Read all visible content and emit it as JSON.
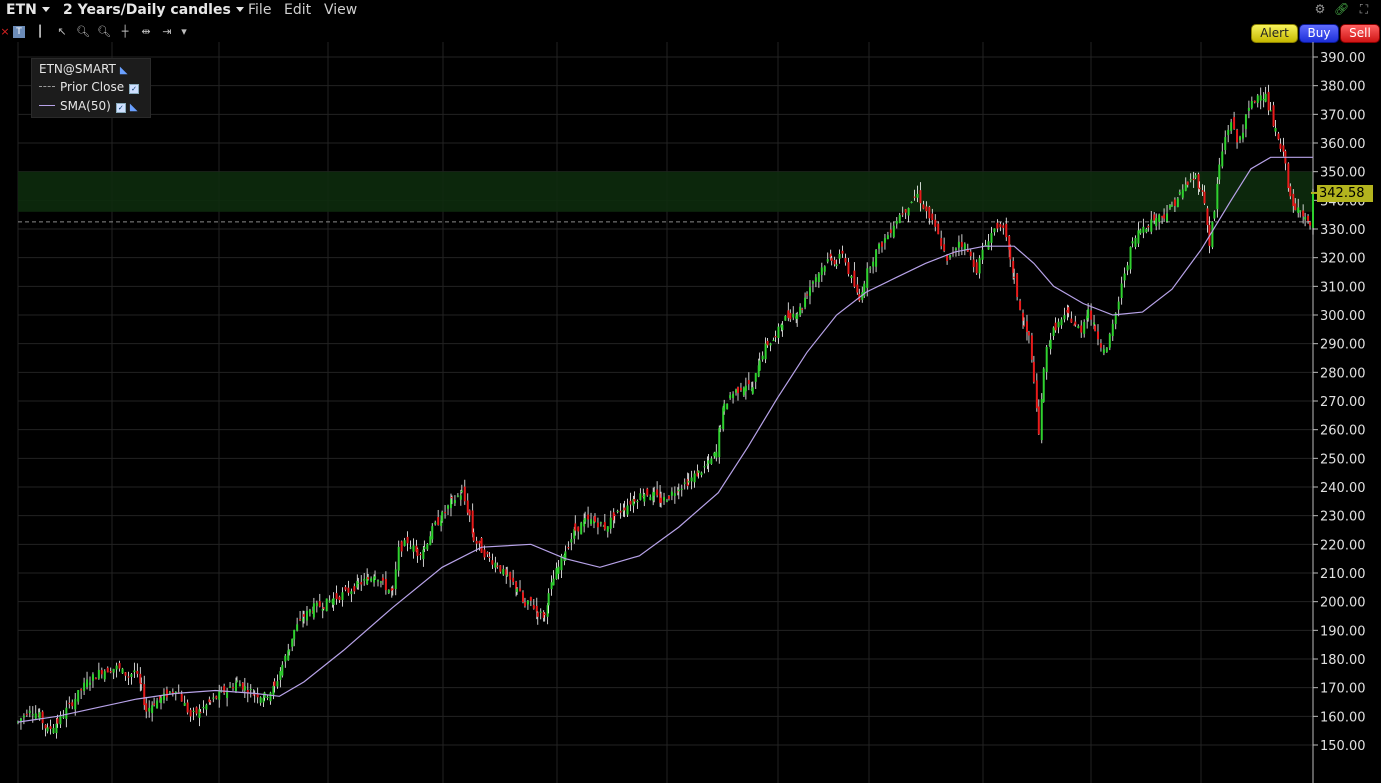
{
  "header": {
    "symbol": "ETN",
    "period": "2 Years/Daily candles",
    "menus": [
      "File",
      "Edit",
      "View"
    ]
  },
  "window_icons": [
    "gear-icon",
    "link-icon",
    "expand-icon"
  ],
  "toolbar": {
    "icons": [
      "close-icon",
      "text-tool-icon",
      "bar-tool-icon",
      "cursor-icon",
      "zoom-in-icon",
      "zoom-out-icon",
      "crosshair-icon",
      "pan-icon",
      "split-icon",
      "dropdown-icon"
    ],
    "alert": "Alert",
    "buy": "Buy",
    "sell": "Sell"
  },
  "legend": {
    "title": "ETN@SMART",
    "prior_close": "Prior Close",
    "sma": "SMA(50)"
  },
  "price_axis": {
    "ticks": [
      "390.00",
      "380.00",
      "370.00",
      "360.00",
      "350.00",
      "340.00",
      "330.00",
      "320.00",
      "310.00",
      "300.00",
      "290.00",
      "280.00",
      "270.00",
      "260.00",
      "250.00",
      "240.00",
      "230.00",
      "220.00",
      "210.00",
      "200.00",
      "190.00",
      "180.00",
      "170.00",
      "160.00",
      "150.00"
    ]
  },
  "last_price": "342.58",
  "colors": {
    "up": "#2fd12f",
    "down": "#e81b1b",
    "sma": "#b7a2e8",
    "band": "#0d2b0d",
    "grid": "#222222",
    "tag": "#b3b41e"
  },
  "chart_data": {
    "type": "line",
    "title": "",
    "ylim": [
      145,
      394
    ],
    "prior_close": 332.5,
    "highlight_band": [
      336,
      350
    ],
    "last": 342.58,
    "series": [
      {
        "name": "ETN@SMART",
        "type": "candlestick-close",
        "x": [
          0,
          12,
          22,
          30,
          40,
          55,
          70,
          85,
          100,
          112,
          118,
          125,
          130,
          138,
          145,
          160,
          175,
          185,
          195,
          206,
          215,
          222,
          230,
          240,
          250,
          260,
          268,
          275,
          280,
          290,
          300,
          310,
          320,
          332,
          345,
          355,
          362,
          370,
          380,
          386,
          395,
          405,
          412,
          420,
          430,
          440,
          450,
          458,
          462,
          470,
          478,
          486,
          496,
          506,
          514,
          520,
          527,
          534,
          538,
          543,
          548,
          555,
          565,
          575,
          585,
          595,
          605,
          615,
          625,
          635,
          645,
          652,
          660,
          670,
          680,
          690,
          700,
          708,
          712,
          716,
          722,
          730,
          738,
          745,
          752,
          760,
          768,
          775,
          783,
          790,
          795,
          800,
          806,
          812,
          818,
          825,
          830,
          836,
          842,
          848,
          853,
          858,
          864,
          870,
          876,
          882,
          888,
          894,
          900,
          906,
          912,
          918,
          924,
          930,
          936,
          942,
          948,
          954,
          960,
          966,
          972,
          978,
          984,
          990,
          996,
          1002,
          1006,
          1010,
          1016,
          1020,
          1025,
          1030,
          1035,
          1040,
          1043,
          1047,
          1052,
          1058,
          1065,
          1072,
          1078,
          1085,
          1092,
          1098,
          1104,
          1110,
          1116,
          1122,
          1130,
          1138,
          1146,
          1154,
          1162,
          1170,
          1178,
          1186,
          1194,
          1198,
          1203,
          1208,
          1213,
          1218,
          1224,
          1230,
          1236,
          1242,
          1248,
          1254,
          1260,
          1265,
          1270,
          1275,
          1280,
          1285,
          1290,
          1295,
          1300,
          1305,
          1310,
          1313
        ],
        "values": [
          158,
          163,
          160,
          155,
          158,
          165,
          172,
          176,
          177,
          174,
          176,
          170,
          162,
          165,
          166,
          170,
          160,
          162,
          165,
          168,
          170,
          172,
          170,
          168,
          167,
          170,
          178,
          184,
          190,
          195,
          198,
          199,
          201,
          203,
          206,
          208,
          210,
          206,
          203,
          218,
          221,
          217,
          219,
          225,
          230,
          235,
          238,
          230,
          222,
          218,
          215,
          213,
          208,
          205,
          198,
          200,
          196,
          195,
          202,
          208,
          212,
          218,
          225,
          228,
          228,
          226,
          230,
          233,
          236,
          238,
          237,
          235,
          237,
          240,
          242,
          245,
          248,
          252,
          262,
          268,
          272,
          274,
          276,
          274,
          285,
          290,
          292,
          298,
          300,
          301,
          303,
          308,
          312,
          315,
          318,
          320,
          318,
          322,
          315,
          310,
          305,
          312,
          318,
          322,
          325,
          328,
          332,
          335,
          337,
          340,
          342,
          338,
          334,
          330,
          325,
          318,
          322,
          326,
          324,
          320,
          316,
          322,
          327,
          330,
          332,
          326,
          320,
          312,
          302,
          296,
          292,
          278,
          258,
          280,
          288,
          292,
          296,
          298,
          300,
          296,
          295,
          302,
          295,
          290,
          288,
          296,
          305,
          315,
          325,
          330,
          332,
          334,
          335,
          338,
          342,
          346,
          348,
          345,
          340,
          325,
          336,
          352,
          362,
          368,
          360,
          365,
          372,
          375,
          378,
          376,
          370,
          364,
          358,
          354,
          340,
          336,
          338,
          334,
          330,
          342.58
        ]
      },
      {
        "name": "SMA(50)",
        "type": "line",
        "x": [
          0,
          40,
          80,
          120,
          160,
          200,
          240,
          265,
          290,
          330,
          380,
          430,
          470,
          520,
          555,
          590,
          630,
          670,
          710,
          740,
          770,
          800,
          830,
          860,
          890,
          920,
          950,
          980,
          1010,
          1030,
          1050,
          1080,
          1110,
          1140,
          1170,
          1200,
          1230,
          1250,
          1270,
          1290,
          1313
        ],
        "values": [
          158,
          160,
          163,
          166,
          168,
          169,
          168,
          167,
          172,
          183,
          198,
          212,
          219,
          220,
          215,
          212,
          216,
          226,
          238,
          254,
          271,
          287,
          300,
          308,
          313,
          318,
          322,
          324,
          324,
          318,
          310,
          304,
          300,
          301,
          309,
          323,
          340,
          351,
          355,
          355,
          355
        ]
      }
    ]
  }
}
